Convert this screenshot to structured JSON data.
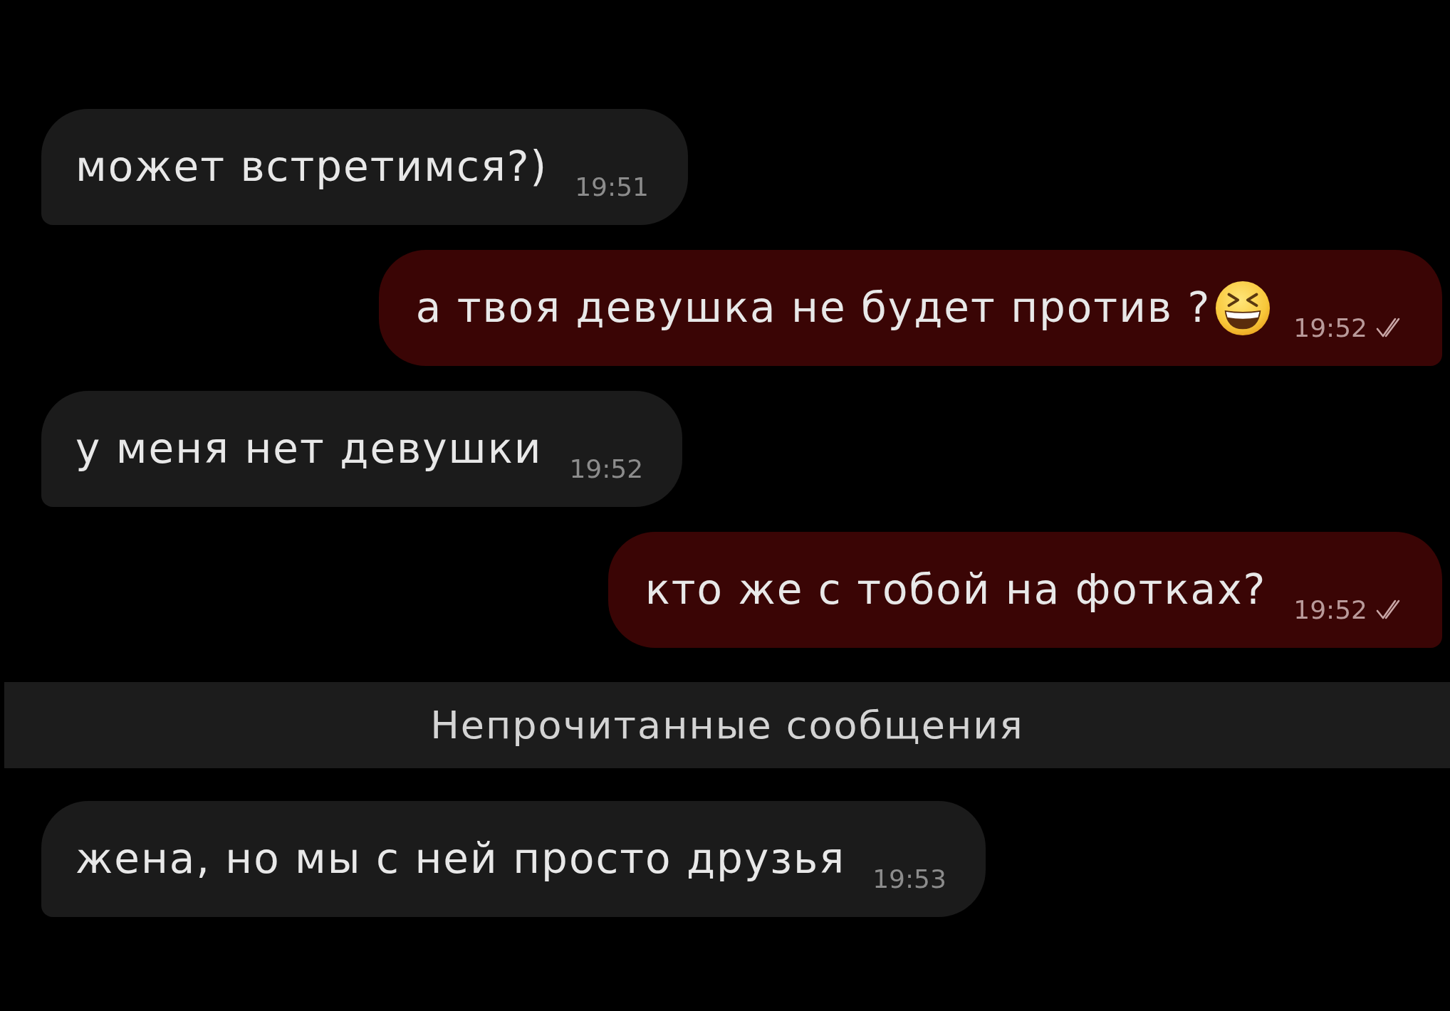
{
  "chat": [
    {
      "kind": "incoming",
      "text": "может встретимся?)",
      "emoji": false,
      "time": "19:51"
    },
    {
      "kind": "outgoing",
      "text": "а твоя девушка не будет против ?",
      "emoji": true,
      "time": "19:52",
      "read": true
    },
    {
      "kind": "incoming",
      "text": "у меня нет девушки",
      "emoji": false,
      "time": "19:52"
    },
    {
      "kind": "outgoing",
      "text": "кто же с тобой на фотках?",
      "emoji": false,
      "time": "19:52",
      "read": true
    },
    {
      "kind": "divider",
      "label": "Непрочитанные сообщения"
    },
    {
      "kind": "incoming",
      "text": "жена, но мы с ней просто друзья",
      "emoji": false,
      "time": "19:53"
    }
  ]
}
